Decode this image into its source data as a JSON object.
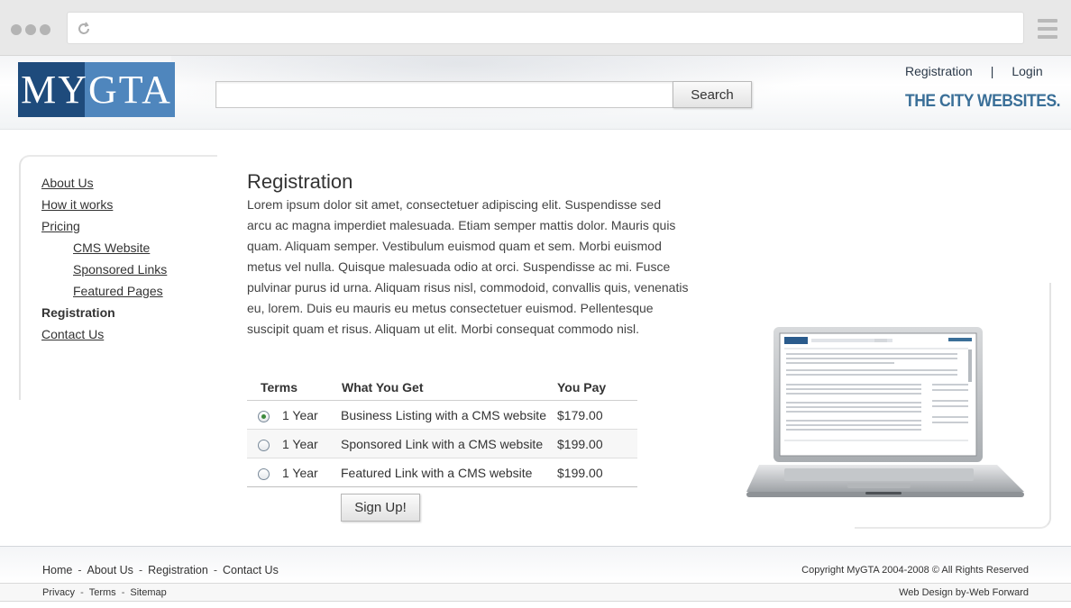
{
  "browser": {
    "url": "",
    "icons": {
      "dots": "window-dots-icon",
      "reload": "reload-icon",
      "menu": "hamburger-menu-icon"
    }
  },
  "header": {
    "logo_text": "MYGTA",
    "search_placeholder": "",
    "search_button": "Search",
    "top_links": {
      "registration": "Registration",
      "separator": "|",
      "login": "Login"
    },
    "tagline": "THE CITY WEBSITES.",
    "colors": {
      "logo_dark": "#1e4b7c",
      "logo_light": "#4f86bd",
      "tagline": "#3a6f98"
    }
  },
  "sidebar": {
    "items": [
      {
        "label": "About Us"
      },
      {
        "label": "How it works"
      },
      {
        "label": "Pricing"
      },
      {
        "label": "CMS Website"
      },
      {
        "label": "Sponsored Links"
      },
      {
        "label": "Featured Pages"
      },
      {
        "label": "Registration"
      },
      {
        "label": "Contact Us"
      }
    ]
  },
  "main": {
    "title": "Registration",
    "body": "Lorem ipsum dolor sit amet, consectetuer adipiscing elit. Suspendisse sed arcu ac magna imperdiet malesuada. Etiam semper mattis dolor. Mauris quis quam. Aliquam semper. Vestibulum euismod quam et sem. Morbi euismod metus vel nulla. Quisque malesuada odio at orci. Suspendisse ac mi. Fusce pulvinar purus id urna. Aliquam risus nisl, commodoid, convallis quis, venenatis eu, lorem. Duis eu mauris eu metus consectetuer euismod. Pellentesque suscipit quam et risus. Aliquam ut elit. Morbi consequat commodo nisl.",
    "table": {
      "headers": {
        "terms": "Terms",
        "what": "What You Get",
        "pay": "You Pay"
      },
      "rows": [
        {
          "term": "1 Year",
          "what": "Business Listing with a CMS website",
          "pay": "$179.00",
          "selected": true
        },
        {
          "term": "1 Year",
          "what": "Sponsored Link with a CMS website",
          "pay": "$199.00",
          "selected": false
        },
        {
          "term": "1 Year",
          "what": "Featured Link with a CMS website",
          "pay": "$199.00",
          "selected": false
        }
      ]
    },
    "signup_button": "Sign Up!"
  },
  "footer": {
    "links": [
      "Home",
      "About Us",
      "Registration",
      "Contact Us"
    ],
    "separator": "-",
    "copyright": "Copyright MyGTA 2004-2008 © All Rights Reserved",
    "sub_links": [
      "Privacy",
      "Terms",
      "Sitemap"
    ],
    "credit_prefix": "Web Design by",
    "credit_name": "Web Forward"
  }
}
